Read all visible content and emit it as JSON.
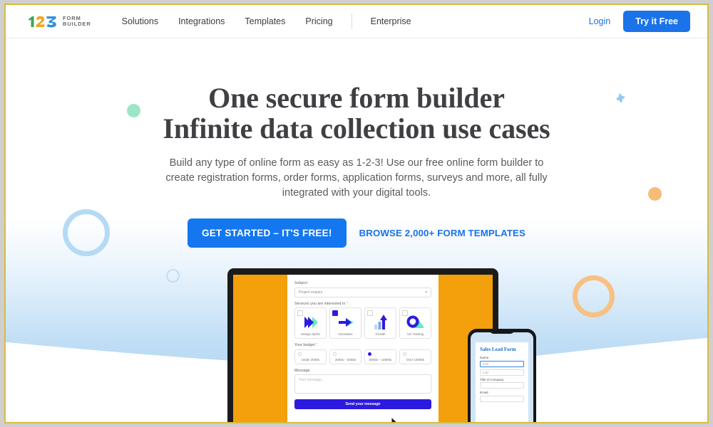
{
  "header": {
    "logo": {
      "digits": [
        "1",
        "2",
        "3"
      ],
      "line1": "FORM",
      "line2": "BUILDER"
    },
    "nav": [
      {
        "label": "Solutions"
      },
      {
        "label": "Integrations"
      },
      {
        "label": "Templates"
      },
      {
        "label": "Pricing"
      },
      {
        "label": "Enterprise"
      }
    ],
    "login_label": "Login",
    "try_label": "Try it Free"
  },
  "hero": {
    "headline_line1": "One secure form builder",
    "headline_line2": "Infinite data collection use cases",
    "subhead": "Build any type of online form as easy as 1-2-3! Use our free online form builder to create registration forms, order forms, application forms, surveys and more, all fully integrated with your digital tools.",
    "cta_primary": "GET STARTED – IT'S FREE!",
    "cta_secondary": "BROWSE 2,000+ FORM TEMPLATES"
  },
  "laptop_form": {
    "subject_label": "Subject",
    "subject_value": "Project enquiry",
    "services_label": "Services you are interested in",
    "required_mark": "*",
    "services": [
      {
        "name": "Design Sprint",
        "checked": false
      },
      {
        "name": "Innovation",
        "checked": true
      },
      {
        "name": "Growth",
        "checked": false
      },
      {
        "name": "UX Training",
        "checked": false
      }
    ],
    "budget_label": "Your budget",
    "budgets": [
      {
        "name": "Under 2000£",
        "selected": false
      },
      {
        "name": "2000£ – 5000£",
        "selected": false
      },
      {
        "name": "5000£ – 10000£",
        "selected": true
      },
      {
        "name": "Over 10000£",
        "selected": false
      }
    ],
    "message_label": "Message",
    "message_placeholder": "Your message...",
    "submit_label": "Send your message"
  },
  "phone_form": {
    "title": "Sales Lead Form",
    "name_label": "Name",
    "first_placeholder": "First",
    "last_placeholder": "Last",
    "company_label": "Title of company",
    "company_value": "",
    "email_label": "Email",
    "email_value": ""
  },
  "decorations": [
    {
      "name": "dot-green",
      "color": "#9ce6c8"
    },
    {
      "name": "ring-blue-large",
      "color": "#b4daf5"
    },
    {
      "name": "ring-blue-small",
      "color": "#bfdff8"
    },
    {
      "name": "plus-blue",
      "color": "#8ecaf2"
    },
    {
      "name": "dot-orange",
      "color": "#f7bc78"
    },
    {
      "name": "ring-orange",
      "color": "#f7c184"
    }
  ],
  "colors": {
    "brand_blue": "#1a73e8",
    "cta_blue": "#1477ef",
    "form_purple": "#2d1ae0",
    "laptop_orange": "#f3a00c",
    "wave_blue": "#a9d2f0",
    "frame_gold": "#d9bb3f"
  }
}
